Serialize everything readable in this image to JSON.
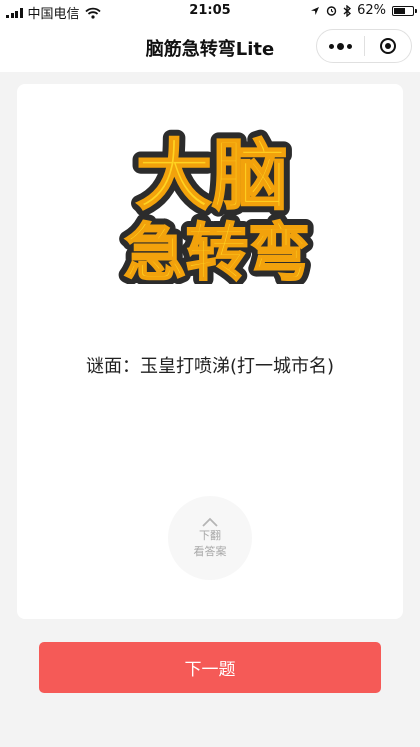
{
  "status_bar": {
    "carrier": "中国电信",
    "time": "21:05",
    "battery_percent": "62%",
    "battery_level": 0.62,
    "icons": [
      "signal-icon",
      "wifi-icon",
      "location-arrow-icon",
      "alarm-icon",
      "bluetooth-icon",
      "battery-icon"
    ]
  },
  "nav": {
    "title": "脑筋急转弯Lite",
    "more_icon": "more-dots-icon",
    "close_icon": "target-close-icon"
  },
  "logo": {
    "text_line1": "大脑",
    "text_line2": "急转弯",
    "colors": {
      "fill": "#ffd321",
      "outline": "#2c2c2c"
    }
  },
  "riddle": {
    "text": "谜面：玉皇打喷涕(打一城市名)"
  },
  "flip_hint": {
    "icon": "chevron-up-icon",
    "line1": "下翻",
    "line2": "看答案"
  },
  "next_button": {
    "label": "下一题",
    "color": "#f55a57"
  }
}
